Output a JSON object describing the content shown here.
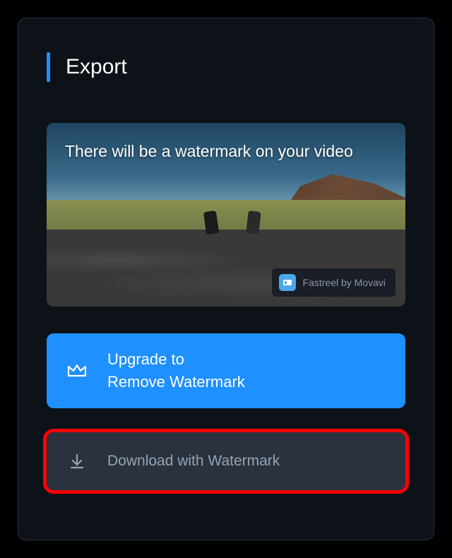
{
  "header": {
    "title": "Export"
  },
  "preview": {
    "overlay_text": "There will be a watermark on your video",
    "watermark_badge": {
      "text": "Fastreel by Movavi"
    }
  },
  "buttons": {
    "upgrade": {
      "label": "Upgrade to\nRemove Watermark"
    },
    "download": {
      "label": "Download with Watermark"
    }
  }
}
